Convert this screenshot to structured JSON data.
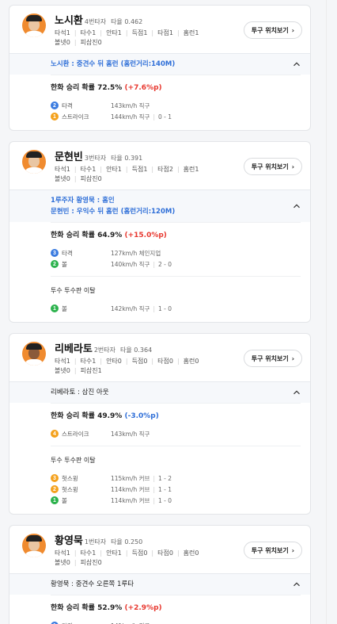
{
  "colors": {
    "accent_blue": "#2f6fd8",
    "up_red": "#e8382f",
    "avatar_orange": "#f08b2f"
  },
  "stat_labels": {
    "pa": "타석",
    "ab": "타수",
    "hit": "안타",
    "rbi": "득점",
    "run": "타점",
    "hr": "홈런",
    "bb": "볼넷",
    "so": "피삼진"
  },
  "pitch_button_label": "투구 위치보기",
  "win_prob_label": "한화 승리 확률",
  "cards": [
    {
      "name": "노시환",
      "order": "4번타자",
      "avg": "타율 0.462",
      "stats": {
        "pa": "1",
        "ab": "1",
        "hit": "1",
        "rbi": "1",
        "run": "1",
        "hr": "1",
        "bb": "0",
        "so": "0"
      },
      "result_lines": [
        "노시환 : 중견수 뒤 홈런 (홈런거리:140M)"
      ],
      "win_prob": "72.5%",
      "delta": "(+7.6%p)",
      "delta_dir": "up",
      "pitches": [
        {
          "num": "2",
          "color": "blue",
          "label": "타격",
          "detail": "143km/h 직구",
          "count": ""
        },
        {
          "num": "1",
          "color": "orange",
          "label": "스트라이크",
          "detail": "144km/h 직구",
          "count": "0 - 1"
        }
      ],
      "events": []
    },
    {
      "name": "문현빈",
      "order": "3번타자",
      "avg": "타율 0.391",
      "stats": {
        "pa": "1",
        "ab": "1",
        "hit": "1",
        "rbi": "1",
        "run": "2",
        "hr": "1",
        "bb": "0",
        "so": "0"
      },
      "result_lines": [
        "1루주자 황영묵 : 홈인",
        "문현빈 : 우익수 뒤 홈런 (홈런거리:120M)"
      ],
      "win_prob": "64.9%",
      "delta": "(+15.0%p)",
      "delta_dir": "up",
      "pitches": [
        {
          "num": "3",
          "color": "blue",
          "label": "타격",
          "detail": "127km/h 체인지업",
          "count": ""
        },
        {
          "num": "2",
          "color": "green",
          "label": "볼",
          "detail": "140km/h 직구",
          "count": "2 - 0"
        }
      ],
      "events": [
        {
          "text": "투수 투수판 이탈",
          "pitches": [
            {
              "num": "1",
              "color": "green",
              "label": "볼",
              "detail": "142km/h 직구",
              "count": "1 - 0"
            }
          ]
        }
      ]
    },
    {
      "name": "리베라토",
      "order": "2번타자",
      "avg": "타율 0.364",
      "stats": {
        "pa": "1",
        "ab": "1",
        "hit": "0",
        "rbi": "0",
        "run": "0",
        "hr": "0",
        "bb": "0",
        "so": "1"
      },
      "result_lines": [
        "리베라토 : 삼진 아웃"
      ],
      "result_plain": true,
      "win_prob": "49.9%",
      "delta": "(-3.0%p)",
      "delta_dir": "down",
      "pitches": [
        {
          "num": "4",
          "color": "orange",
          "label": "스트라이크",
          "detail": "143km/h 직구",
          "count": ""
        }
      ],
      "events": [
        {
          "text": "투수 투수판 이탈",
          "pitches": [
            {
              "num": "3",
              "color": "orange",
              "label": "헛스윙",
              "detail": "115km/h 커브",
              "count": "1 - 2"
            },
            {
              "num": "2",
              "color": "orange",
              "label": "헛스윙",
              "detail": "114km/h 커브",
              "count": "1 - 1"
            },
            {
              "num": "1",
              "color": "green",
              "label": "볼",
              "detail": "114km/h 커브",
              "count": "1 - 0"
            }
          ]
        }
      ]
    },
    {
      "name": "황영묵",
      "order": "1번타자",
      "avg": "타율 0.250",
      "stats": {
        "pa": "1",
        "ab": "1",
        "hit": "1",
        "rbi": "0",
        "run": "0",
        "hr": "0",
        "bb": "0",
        "so": "0"
      },
      "result_lines": [
        "황영묵 : 중견수 오른쪽 1루타"
      ],
      "result_plain": true,
      "win_prob": "52.9%",
      "delta": "(+2.9%p)",
      "delta_dir": "up",
      "pitches": [
        {
          "num": "1",
          "color": "blue",
          "label": "타격",
          "detail": "141km/h 직구",
          "count": ""
        }
      ],
      "events": []
    }
  ]
}
